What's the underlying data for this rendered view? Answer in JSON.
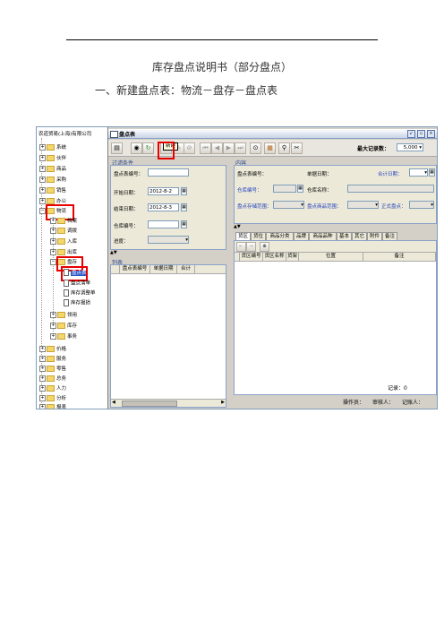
{
  "document": {
    "title": "库存盘点说明书（部分盘点）",
    "heading": "一、新建盘点表：物流－盘存－盘点表"
  },
  "tree": {
    "root": "农道贸易(上海)有限公司",
    "items": [
      "系统",
      "伙伴",
      "商品",
      "采购",
      "销售",
      "办公",
      "物流"
    ],
    "logistics_children": [
      "档案",
      "调拨",
      "入库",
      "出库",
      "盘存"
    ],
    "inventory_children": [
      "盘点表",
      "盘点清单",
      "库存调整单",
      "库存报损"
    ],
    "after": [
      "领用",
      "库存",
      "事务"
    ],
    "bottom": [
      "价格",
      "服务",
      "零售",
      "总务",
      "人力",
      "分析",
      "报表"
    ]
  },
  "window": {
    "title": "盘点表",
    "tooltip": "新建",
    "max_records_label": "最大记录数：",
    "max_records_value": "5,000"
  },
  "filter": {
    "panel_label": "过滤条件",
    "no_label": "盘点表编号：",
    "start_label": "开始日期：",
    "start_value": "2012-8-2",
    "end_label": "结束日期：",
    "end_value": "2012-8-3",
    "warehouse_label": "仓库编号：",
    "progress_label": "进度："
  },
  "list": {
    "panel_label": "列表",
    "columns": [
      "盘点表编号",
      "单据日期",
      "合计"
    ]
  },
  "content": {
    "panel_label": "内容",
    "no_label": "盘点表编号：",
    "doc_date_label": "单据日期：",
    "total_date_label": "合计日期：",
    "wh_no_label": "仓库编号：",
    "wh_name_label": "仓库名称：",
    "storage_label": "盘点存储范围：",
    "goods_label": "盘点商品范围：",
    "formal_label": "正式盘点：",
    "tabs": [
      "货区",
      "货位",
      "商品分类",
      "品牌",
      "商品品种",
      "基本",
      "其它",
      "附件",
      "备注"
    ],
    "columns": [
      "货区编号",
      "货区名称",
      "货架",
      "位置",
      "备注"
    ],
    "records_label": "记录：",
    "records_value": "0",
    "operator_label": "操作员：",
    "reviewer_label": "审核人：",
    "recorder_label": "记账人："
  }
}
